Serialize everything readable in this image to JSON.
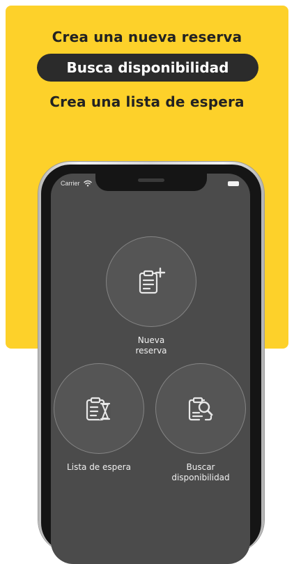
{
  "banner": {
    "headline_1": "Crea una nueva reserva",
    "headline_2": "Busca disponibilidad",
    "headline_3": "Crea una lista de espera",
    "background_color": "#fdd12a",
    "pill_color": "#2b2b2b"
  },
  "status_bar": {
    "carrier": "Carrier",
    "wifi_icon": "wifi-icon",
    "battery_icon": "battery-icon"
  },
  "actions": [
    {
      "label": "Nueva\nreserva",
      "icon": "new-reservation-icon"
    },
    {
      "label": "Lista de espera",
      "icon": "waitlist-icon"
    },
    {
      "label": "Buscar\ndisponibilidad",
      "icon": "search-availability-icon"
    }
  ],
  "screen_color": "#4b4b4b"
}
